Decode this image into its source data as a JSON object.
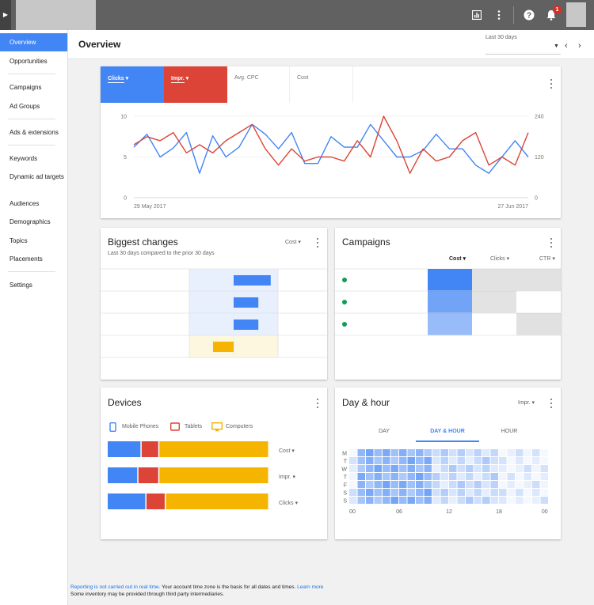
{
  "topbar": {
    "icons": [
      "reports-icon",
      "more-vert-icon",
      "help-icon",
      "notifications-icon"
    ],
    "notification_count": "1"
  },
  "sidebar": {
    "items": [
      {
        "label": "Overview",
        "active": true
      },
      {
        "label": "Opportunities"
      },
      {
        "label": "Campaigns"
      },
      {
        "label": "Ad Groups"
      },
      {
        "label": "Ads & extensions"
      },
      {
        "label": "Keywords"
      },
      {
        "label": "Dynamic ad targets"
      },
      {
        "label": "Audiences"
      },
      {
        "label": "Demographics"
      },
      {
        "label": "Topics"
      },
      {
        "label": "Placements"
      },
      {
        "label": "Settings"
      }
    ]
  },
  "header": {
    "title": "Overview",
    "date_range": "Last 30 days"
  },
  "colors": {
    "blue": "#4285f4",
    "red": "#db4437",
    "yellow": "#f4b400",
    "green": "#0f9d58"
  },
  "metrics": {
    "clicks": "Clicks",
    "impr": "Impr.",
    "avg_cpc": "Avg. CPC",
    "cost": "Cost"
  },
  "chart_data": {
    "type": "line",
    "x_labels": {
      "start": "29 May 2017",
      "end": "27 Jun 2017"
    },
    "left_axis": {
      "ticks": [
        "10",
        "5",
        "0"
      ],
      "ylim": [
        0,
        10
      ]
    },
    "right_axis": {
      "ticks": [
        "240",
        "120",
        "0"
      ],
      "ylim": [
        0,
        240
      ]
    },
    "series": [
      {
        "name": "Clicks",
        "color": "#4285f4",
        "values": [
          6.2,
          7.8,
          5.0,
          6.1,
          8.0,
          3.0,
          7.6,
          5.0,
          6.2,
          9.0,
          7.8,
          6.0,
          8.0,
          4.2,
          4.2,
          7.5,
          6.2,
          6.2,
          9.0,
          7.0,
          5.0,
          5.0,
          5.8,
          7.8,
          6.0,
          6.0,
          4.0,
          3.0,
          5.0,
          7.0,
          5.0
        ],
        "axis": "left"
      },
      {
        "name": "Impr.",
        "color": "#db4437",
        "values": [
          156,
          180,
          168,
          192,
          132,
          156,
          132,
          168,
          192,
          216,
          144,
          96,
          144,
          108,
          120,
          120,
          108,
          168,
          120,
          240,
          168,
          72,
          144,
          108,
          120,
          168,
          192,
          96,
          120,
          96,
          192
        ],
        "axis": "right"
      }
    ]
  },
  "biggest_changes": {
    "title": "Biggest changes",
    "subtitle": "Last 30 days compared to the prior 30 days",
    "metric": "Cost",
    "changes": [
      0.9,
      0.6,
      0.6,
      -0.5
    ]
  },
  "campaigns": {
    "title": "Campaigns",
    "columns": [
      "Cost",
      "Clicks",
      "CTR"
    ],
    "rows": [
      {
        "cost_shade": 1.0,
        "clicks_shade": 0.5,
        "ctr_shade": 0.55
      },
      {
        "cost_shade": 0.75,
        "clicks_shade": 0.45,
        "ctr_shade": 0.0
      },
      {
        "cost_shade": 0.55,
        "clicks_shade": 0.0,
        "ctr_shade": 0.6
      }
    ]
  },
  "devices": {
    "title": "Devices",
    "legend": [
      "Mobile Phones",
      "Tablets",
      "Computers"
    ],
    "rows": [
      {
        "metric": "Cost",
        "shares": [
          0.21,
          0.11,
          0.68
        ]
      },
      {
        "metric": "Impr.",
        "shares": [
          0.19,
          0.13,
          0.68
        ]
      },
      {
        "metric": "Clicks",
        "shares": [
          0.24,
          0.12,
          0.64
        ]
      }
    ]
  },
  "day_hour": {
    "title": "Day & hour",
    "metric": "Impr.",
    "tabs": [
      "DAY",
      "DAY & HOUR",
      "HOUR"
    ],
    "active_tab": 1,
    "days": [
      "M",
      "T",
      "W",
      "T",
      "F",
      "S",
      "S"
    ],
    "hour_labels": [
      "00",
      "06",
      "12",
      "18",
      "00"
    ]
  },
  "footer": {
    "link1": "Reporting is not carried out in real time.",
    "text1": " Your account time zone is the basis for all dates and times. ",
    "link2": "Learn more",
    "line2": "Some inventory may be provided through third party intermediaries."
  }
}
